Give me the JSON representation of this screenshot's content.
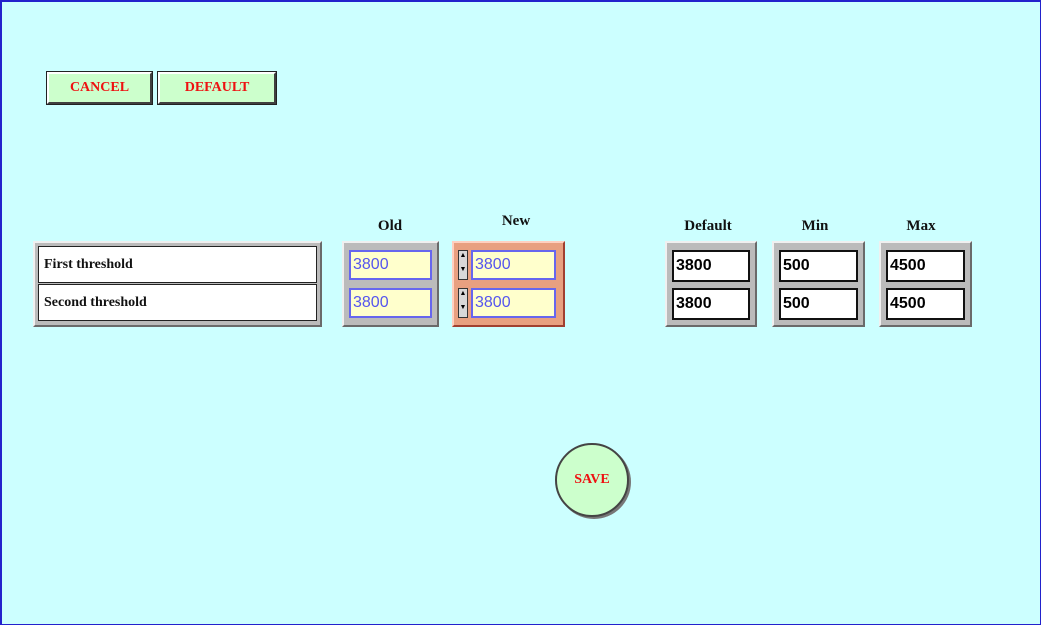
{
  "toolbar": {
    "cancel_label": "CANCEL",
    "default_label": "DEFAULT"
  },
  "columns": {
    "old": "Old",
    "new": "New",
    "default": "Default",
    "min": "Min",
    "max": "Max"
  },
  "rows": [
    {
      "label": "First threshold",
      "old": "3800",
      "new": "3800",
      "default": "3800",
      "min": "500",
      "max": "4500"
    },
    {
      "label": "Second threshold",
      "old": "3800",
      "new": "3800",
      "default": "3800",
      "min": "500",
      "max": "4500"
    }
  ],
  "save_label": "SAVE",
  "colors": {
    "background": "#ccffff",
    "button_bg": "#ccffcc",
    "button_text": "#ee1111",
    "new_group_bg": "#e8a080",
    "editable_text": "#5555ee"
  },
  "icons": {
    "spin_up": "triangle-up-icon",
    "spin_down": "triangle-down-icon"
  }
}
